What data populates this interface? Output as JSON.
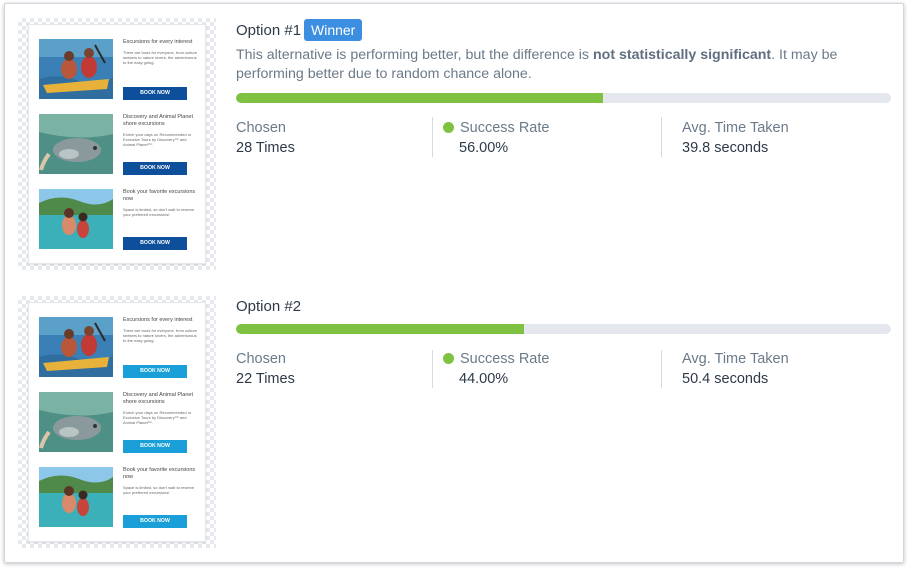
{
  "options": [
    {
      "title": "Option #1",
      "badge": "Winner",
      "description_pre": "This alternative is performing better, but the difference is ",
      "description_bold": "not statistically significant",
      "description_post": ". It may be performing better due to random chance alone.",
      "progress_percent": 56,
      "chosen_label": "Chosen",
      "chosen_value": "28 Times",
      "rate_label": "Success Rate",
      "rate_value": "56.00%",
      "time_label": "Avg. Time Taken",
      "time_value": "39.8 seconds",
      "email": {
        "button_color": "#0d4f9a",
        "rows": [
          {
            "title": "Excursions for every interest",
            "body": "There are tours for everyone, from culture seekers to nature lovers, the adventurous to the easy going.",
            "button": "BOOK NOW"
          },
          {
            "title": "Discovery and Animal Planet shore excursions",
            "body": "Enrich your days on Recommended or Exclusive Tours by Discovery™ and Animal Planet™.",
            "button": "BOOK NOW"
          },
          {
            "title": "Book your favorite excursions now",
            "body": "Space is limited, so don't wait to reserve your preferred excursions!",
            "button": "BOOK NOW"
          }
        ]
      }
    },
    {
      "title": "Option #2",
      "progress_percent": 44,
      "chosen_label": "Chosen",
      "chosen_value": "22 Times",
      "rate_label": "Success Rate",
      "rate_value": "44.00%",
      "time_label": "Avg. Time Taken",
      "time_value": "50.4 seconds",
      "email": {
        "button_color": "#1a9fd8",
        "rows": [
          {
            "title": "Excursions for every interest",
            "body": "There are tours for everyone, from culture seekers to nature lovers, the adventurous to the easy going.",
            "button": "BOOK NOW"
          },
          {
            "title": "Discovery and Animal Planet shore excursions",
            "body": "Enrich your days on Recommended or Exclusive Tours by Discovery™ and Animal Planet™.",
            "button": "BOOK NOW"
          },
          {
            "title": "Book your favorite excursions now",
            "body": "Space is limited, so don't wait to reserve your preferred excursions!",
            "button": "BOOK NOW"
          }
        ]
      }
    }
  ],
  "colors": {
    "progress": "#7fc241",
    "track": "#e4e8ee",
    "badge": "#3c8fe0",
    "success_dot": "#7fc241"
  },
  "icons": {
    "success_indicator": "green-dot-icon"
  }
}
